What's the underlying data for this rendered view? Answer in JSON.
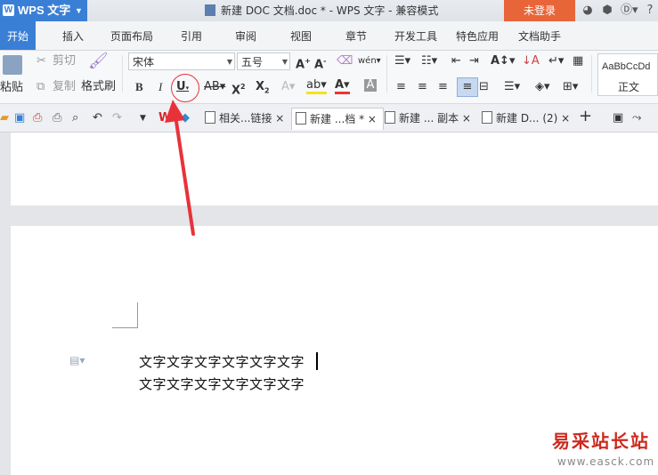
{
  "app": {
    "name": "WPS 文字",
    "logo_glyph": "W"
  },
  "title": {
    "text": "新建 DOC 文档.doc * - WPS 文字 - 兼容模式"
  },
  "login": {
    "label": "未登录"
  },
  "menu": {
    "tabs": [
      "开始",
      "插入",
      "页面布局",
      "引用",
      "审阅",
      "视图",
      "章节",
      "开发工具",
      "特色应用",
      "文档助手"
    ]
  },
  "ribbon": {
    "paste_label": "粘贴",
    "cut_label": "剪切",
    "copy_label": "复制",
    "format_painter_label": "格式刷",
    "font_name": "宋体",
    "font_size": "五号",
    "style_sample": "AaBbCcDd",
    "style_name": "正文"
  },
  "doc_tabs": [
    {
      "label": "相关...链接"
    },
    {
      "label": "新建 ...档 *"
    },
    {
      "label": "新建 ... 副本"
    },
    {
      "label": "新建 D... (2)"
    }
  ],
  "document": {
    "lines": [
      "文字文字文字文字文字文字",
      "文字文字文字文字文字文字"
    ]
  },
  "watermark": {
    "site_name": "易采站长站",
    "url": "www.easck.com"
  },
  "colors": {
    "accent": "#3a7fd6",
    "login": "#e8653a",
    "annotation": "#e8323a"
  }
}
